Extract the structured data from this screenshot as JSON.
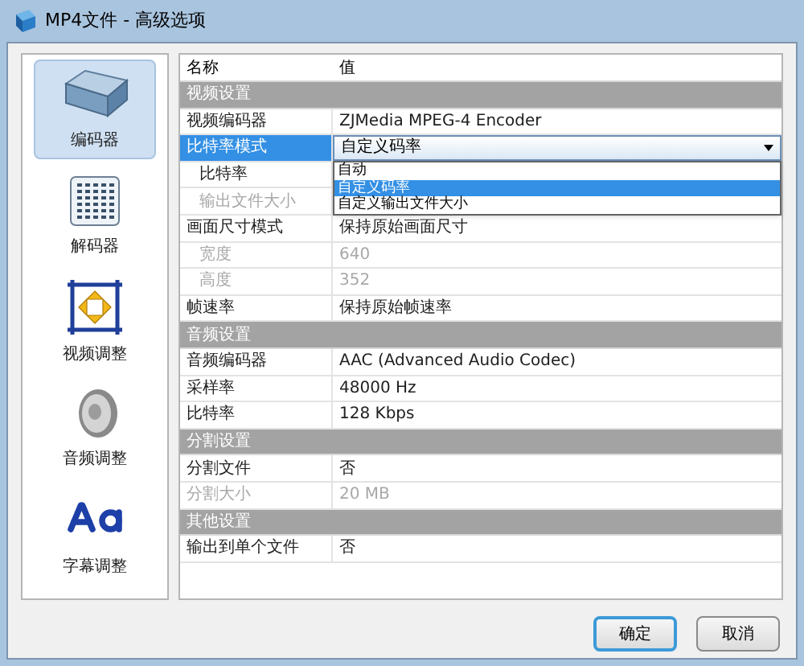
{
  "window": {
    "title": "MP4文件 - 高级选项"
  },
  "sidebar": {
    "items": [
      {
        "label": "编码器",
        "kind": "encoder",
        "selected": true
      },
      {
        "label": "解码器",
        "kind": "decoder",
        "selected": false
      },
      {
        "label": "视频调整",
        "kind": "video",
        "selected": false
      },
      {
        "label": "音频调整",
        "kind": "audio",
        "selected": false
      },
      {
        "label": "字幕调整",
        "kind": "subtitle",
        "selected": false
      }
    ]
  },
  "grid": {
    "columns": [
      "名称",
      "值"
    ],
    "rows": [
      {
        "kind": "category",
        "label": "视频设置"
      },
      {
        "kind": "property",
        "label": "视频编码器",
        "value": "ZJMedia MPEG-4 Encoder",
        "disabled": false,
        "selected": false
      },
      {
        "kind": "combo",
        "label": "比特率模式",
        "value": "自定义码率",
        "selected": true,
        "expanded": true,
        "options": [
          {
            "label": "自动",
            "selected": false
          },
          {
            "label": "自定义码率",
            "selected": true
          },
          {
            "label": "自定义输出文件大小",
            "selected": false
          }
        ],
        "children": [
          {
            "label": "比特率",
            "disabled": false,
            "selected": false
          },
          {
            "label": "输出文件大小",
            "disabled": true,
            "selected": false
          }
        ]
      },
      {
        "kind": "property",
        "label": "画面尺寸模式",
        "value": "保持原始画面尺寸",
        "disabled": false,
        "selected": false,
        "children": [
          {
            "label": "宽度",
            "value": "640",
            "disabled": true,
            "selected": false
          },
          {
            "label": "高度",
            "value": "352",
            "disabled": true,
            "selected": false
          }
        ]
      },
      {
        "kind": "property",
        "label": "帧速率",
        "value": "保持原始帧速率",
        "disabled": false,
        "selected": false
      },
      {
        "kind": "category",
        "label": "音频设置"
      },
      {
        "kind": "property",
        "label": "音频编码器",
        "value": "AAC (Advanced Audio Codec)",
        "disabled": false,
        "selected": false
      },
      {
        "kind": "property",
        "label": "采样率",
        "value": "48000 Hz",
        "disabled": false,
        "selected": false
      },
      {
        "kind": "property",
        "label": "比特率",
        "value": "128 Kbps",
        "disabled": false,
        "selected": false
      },
      {
        "kind": "category",
        "label": "分割设置"
      },
      {
        "kind": "property",
        "label": "分割文件",
        "value": "否",
        "disabled": false,
        "selected": false
      },
      {
        "kind": "property",
        "label": "分割大小",
        "value": "20 MB",
        "disabled": true,
        "selected": false
      },
      {
        "kind": "category",
        "label": "其他设置"
      },
      {
        "kind": "property",
        "label": "输出到单个文件",
        "value": "否",
        "disabled": false,
        "selected": false
      }
    ]
  },
  "buttons": [
    {
      "label": "确定",
      "default": true
    },
    {
      "label": "取消",
      "default": false
    }
  ]
}
